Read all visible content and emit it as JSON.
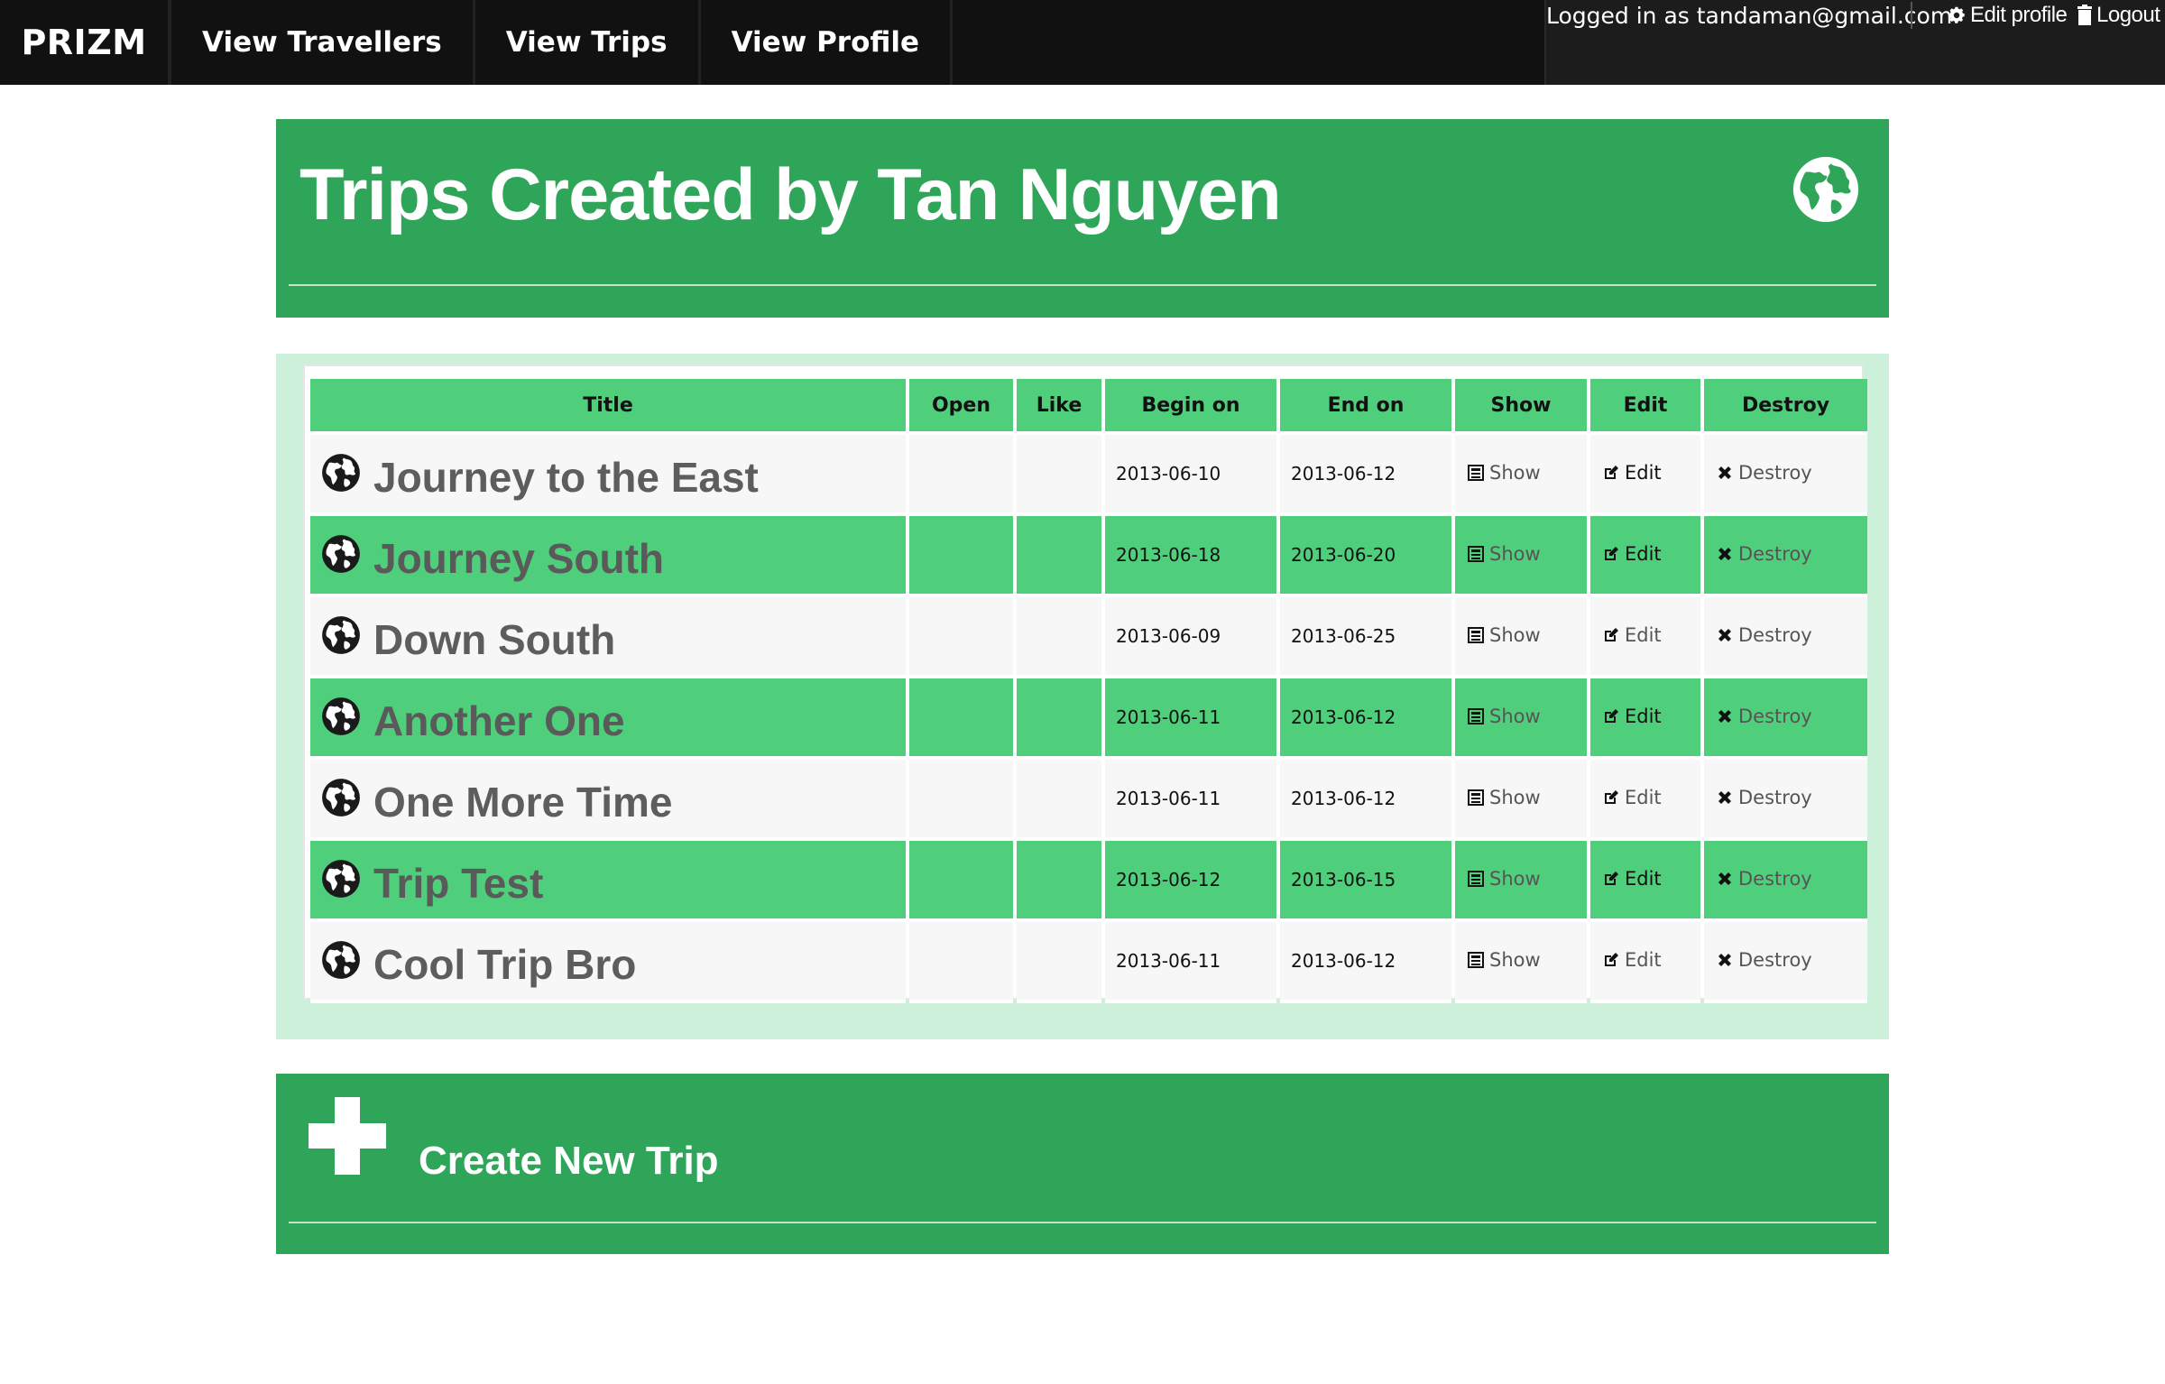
{
  "nav": {
    "brand": "PRIZM",
    "items": [
      {
        "label": "View Travellers"
      },
      {
        "label": "View Trips"
      },
      {
        "label": "View Profile"
      }
    ],
    "logged_in": "Logged in as tandaman@gmail.com",
    "edit_profile": "Edit profile",
    "logout": "Logout"
  },
  "header": {
    "title": "Trips Created by Tan Nguyen",
    "icon": "globe-icon"
  },
  "table": {
    "columns": [
      "Title",
      "Open",
      "Like",
      "Begin on",
      "End on",
      "Show",
      "Edit",
      "Destroy"
    ],
    "action_labels": {
      "show": "Show",
      "edit": "Edit",
      "destroy": "Destroy"
    },
    "rows": [
      {
        "title": "Journey to the East",
        "open": "",
        "like": "",
        "begin_on": "2013-06-10",
        "end_on": "2013-06-12"
      },
      {
        "title": "Journey South",
        "open": "",
        "like": "",
        "begin_on": "2013-06-18",
        "end_on": "2013-06-20"
      },
      {
        "title": "Down South",
        "open": "",
        "like": "",
        "begin_on": "2013-06-09",
        "end_on": "2013-06-25"
      },
      {
        "title": "Another One",
        "open": "",
        "like": "",
        "begin_on": "2013-06-11",
        "end_on": "2013-06-12"
      },
      {
        "title": "One More Time",
        "open": "",
        "like": "",
        "begin_on": "2013-06-11",
        "end_on": "2013-06-12"
      },
      {
        "title": "Trip Test",
        "open": "",
        "like": "",
        "begin_on": "2013-06-12",
        "end_on": "2013-06-15"
      },
      {
        "title": "Cool Trip Bro",
        "open": "",
        "like": "",
        "begin_on": "2013-06-11",
        "end_on": "2013-06-12"
      }
    ]
  },
  "create": {
    "label": "Create New Trip",
    "icon": "plus-icon"
  },
  "colors": {
    "navbar": "#111111",
    "panel_green": "#2ea558",
    "row_green": "#4fce7b",
    "table_bg": "#cdf0da"
  }
}
